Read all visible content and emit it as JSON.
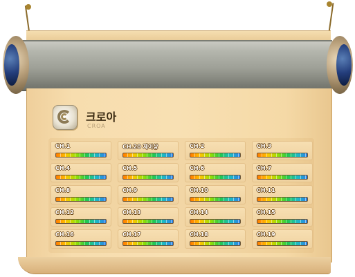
{
  "world": {
    "name": "크로아",
    "subtitle": "CROA"
  },
  "channels": [
    {
      "label": "CH.1",
      "load": 1.0
    },
    {
      "label": "CH.20 제이상",
      "load": 1.0
    },
    {
      "label": "CH.2",
      "load": 1.0
    },
    {
      "label": "CH.3",
      "load": 1.0
    },
    {
      "label": "CH.4",
      "load": 1.0
    },
    {
      "label": "CH.5",
      "load": 1.0
    },
    {
      "label": "CH.6",
      "load": 1.0
    },
    {
      "label": "CH.7",
      "load": 1.0
    },
    {
      "label": "CH.8",
      "load": 1.0
    },
    {
      "label": "CH.9",
      "load": 1.0
    },
    {
      "label": "CH.10",
      "load": 1.0
    },
    {
      "label": "CH.11",
      "load": 1.0
    },
    {
      "label": "CH.12",
      "load": 1.0
    },
    {
      "label": "CH.13",
      "load": 1.0
    },
    {
      "label": "CH.14",
      "load": 1.0
    },
    {
      "label": "CH.15",
      "load": 1.0
    },
    {
      "label": "CH.16",
      "load": 1.0
    },
    {
      "label": "CH.17",
      "load": 1.0
    },
    {
      "label": "CH.18",
      "load": 1.0
    },
    {
      "label": "CH.19",
      "load": 1.0
    }
  ]
}
